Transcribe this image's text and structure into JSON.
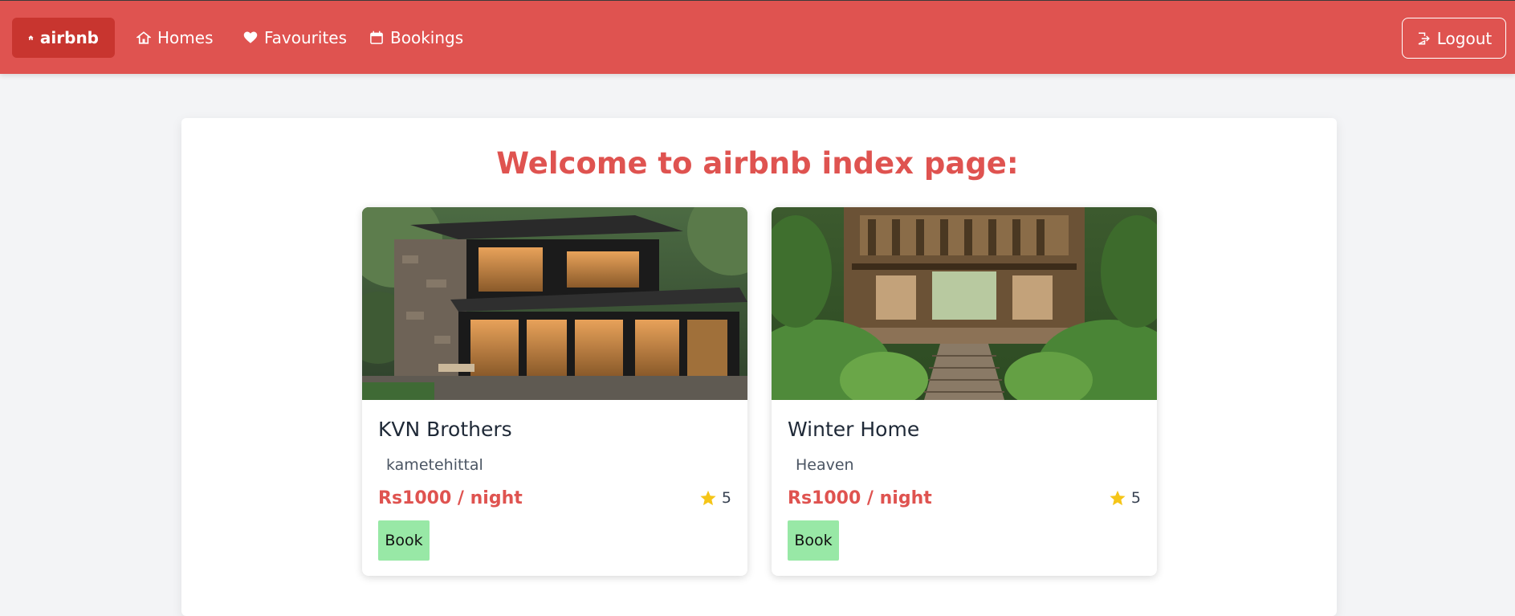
{
  "nav": {
    "brand": "airbnb",
    "items": [
      {
        "label": "Homes",
        "icon": "house-icon"
      },
      {
        "label": "Favourites",
        "icon": "heart-icon"
      },
      {
        "label": "Bookings",
        "icon": "calendar-icon"
      }
    ],
    "logout_label": "Logout"
  },
  "main": {
    "heading": "Welcome to airbnb index page:"
  },
  "homes": [
    {
      "name": "KVN Brothers",
      "location": "kametehittal",
      "price": "Rs1000 / night",
      "rating": "5",
      "book_label": "Book"
    },
    {
      "name": "Winter Home",
      "location": "Heaven",
      "price": "Rs1000 / night",
      "rating": "5",
      "book_label": "Book"
    }
  ],
  "colors": {
    "brand": "#df5350",
    "brand_dark": "#c8352f",
    "book_button": "#98e8a6",
    "star": "#f5c518"
  }
}
